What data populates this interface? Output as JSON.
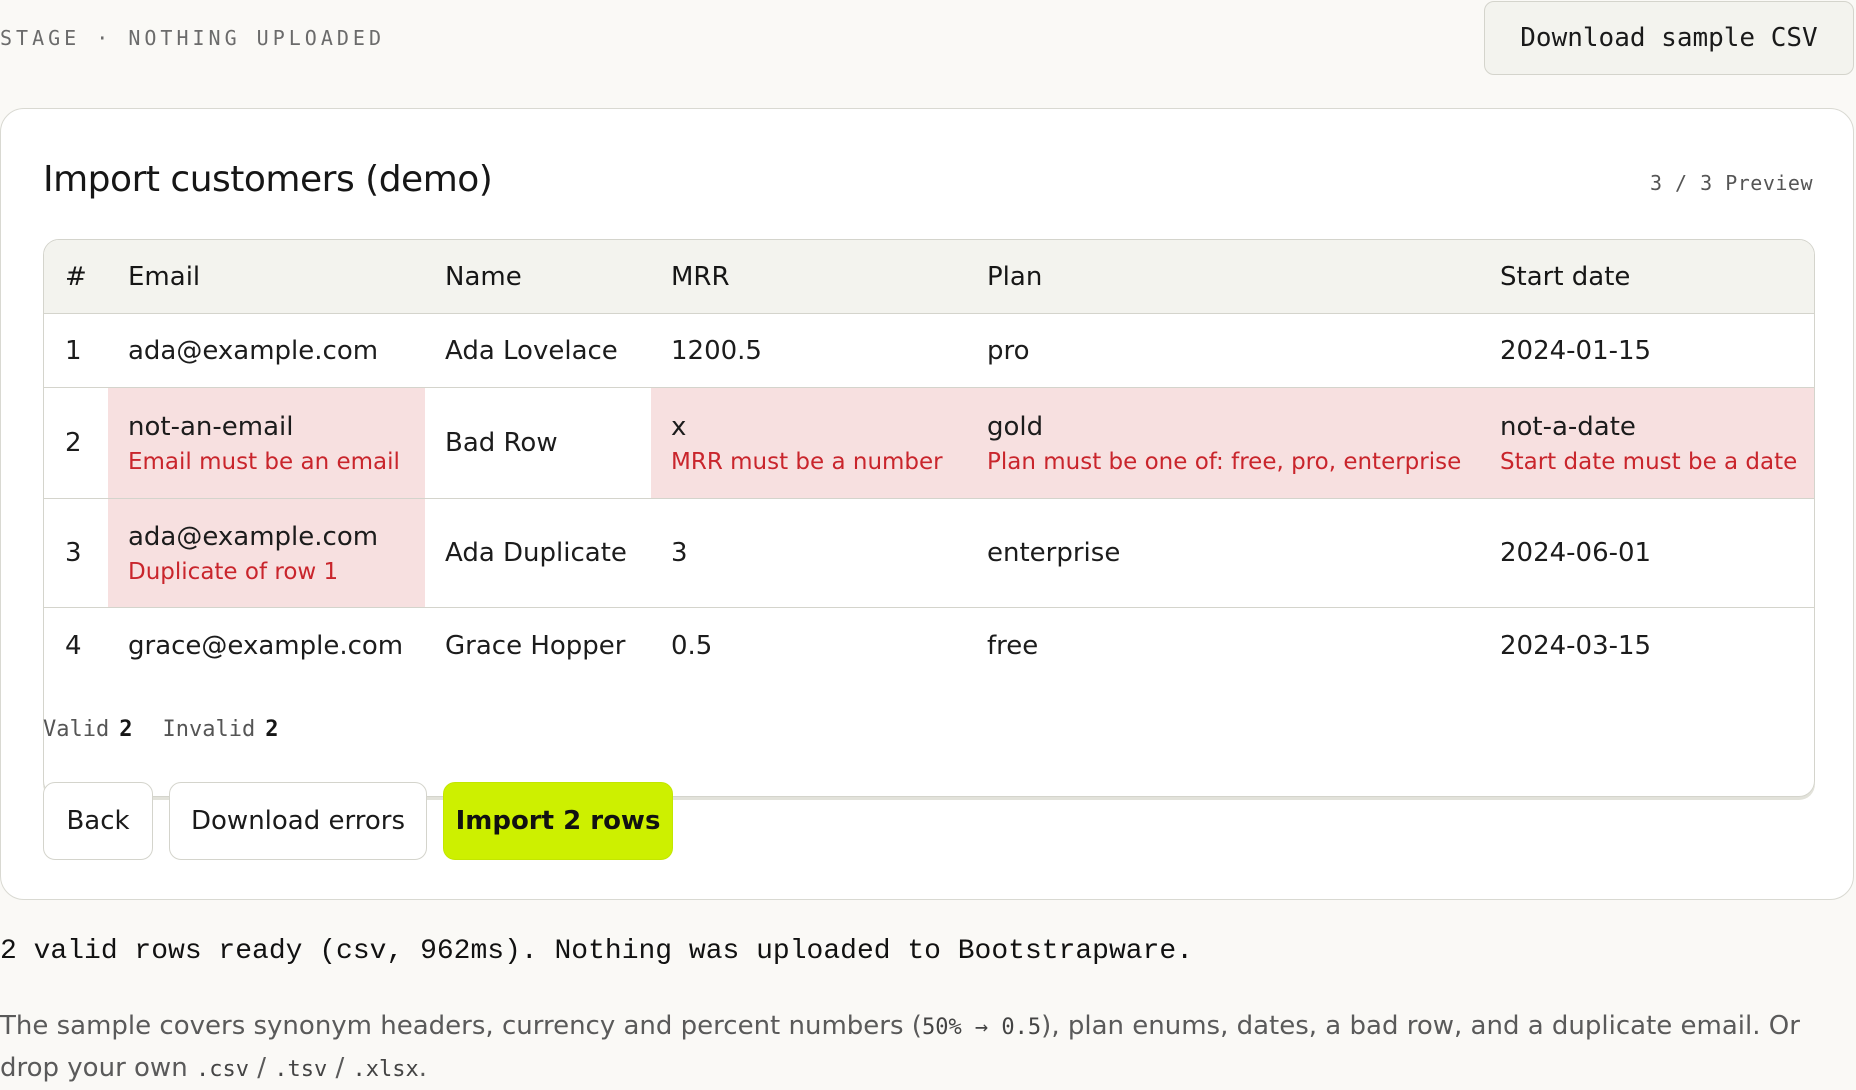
{
  "stage_label": "STAGE · NOTHING UPLOADED",
  "sample_button_label": "Download sample CSV",
  "card": {
    "title": "Import customers (demo)",
    "preview_count": "3 / 3 Preview"
  },
  "table": {
    "headers": [
      "#",
      "Email",
      "Name",
      "MRR",
      "Plan",
      "Start date"
    ],
    "rows": [
      {
        "num": "1",
        "email": {
          "value": "ada@example.com",
          "error": ""
        },
        "name": {
          "value": "Ada Lovelace",
          "error": ""
        },
        "mrr": {
          "value": "1200.5",
          "error": ""
        },
        "plan": {
          "value": "pro",
          "error": ""
        },
        "start_date": {
          "value": "2024-01-15",
          "error": ""
        }
      },
      {
        "num": "2",
        "email": {
          "value": "not-an-email",
          "error": "Email must be an email"
        },
        "name": {
          "value": "Bad Row",
          "error": ""
        },
        "mrr": {
          "value": "x",
          "error": "MRR must be a number"
        },
        "plan": {
          "value": "gold",
          "error": "Plan must be one of: free, pro, enterprise"
        },
        "start_date": {
          "value": "not-a-date",
          "error": "Start date must be a date"
        }
      },
      {
        "num": "3",
        "email": {
          "value": "ada@example.com",
          "error": "Duplicate of row 1"
        },
        "name": {
          "value": "Ada Duplicate",
          "error": ""
        },
        "mrr": {
          "value": "3",
          "error": ""
        },
        "plan": {
          "value": "enterprise",
          "error": ""
        },
        "start_date": {
          "value": "2024-06-01",
          "error": ""
        }
      },
      {
        "num": "4",
        "email": {
          "value": "grace@example.com",
          "error": ""
        },
        "name": {
          "value": "Grace Hopper",
          "error": ""
        },
        "mrr": {
          "value": "0.5",
          "error": ""
        },
        "plan": {
          "value": "free",
          "error": ""
        },
        "start_date": {
          "value": "2024-03-15",
          "error": ""
        }
      }
    ]
  },
  "summary": {
    "valid_label": "Valid",
    "valid_count": "2",
    "invalid_label": "Invalid",
    "invalid_count": "2"
  },
  "actions": {
    "back_label": "Back",
    "download_errors_label": "Download errors",
    "import_label": "Import 2 rows"
  },
  "status_line": "2 valid rows ready (csv, 962ms). Nothing was uploaded to Bootstrapware.",
  "note": {
    "text_1": "The sample covers synonym headers, currency and percent numbers (",
    "code_1": "50% → 0.5",
    "text_2": "), plan enums, dates, a bad row, and a duplicate email. Or drop your own ",
    "code_2": ".csv",
    "sep_1": " / ",
    "code_3": ".tsv",
    "sep_2": " / ",
    "code_4": ".xlsx",
    "text_3": "."
  },
  "colors": {
    "accent": "#cdf000",
    "error_text": "#c9252c",
    "error_bg": "#f7e0e0",
    "header_bg": "#f3f3ee",
    "page_bg": "#faf9f6"
  }
}
